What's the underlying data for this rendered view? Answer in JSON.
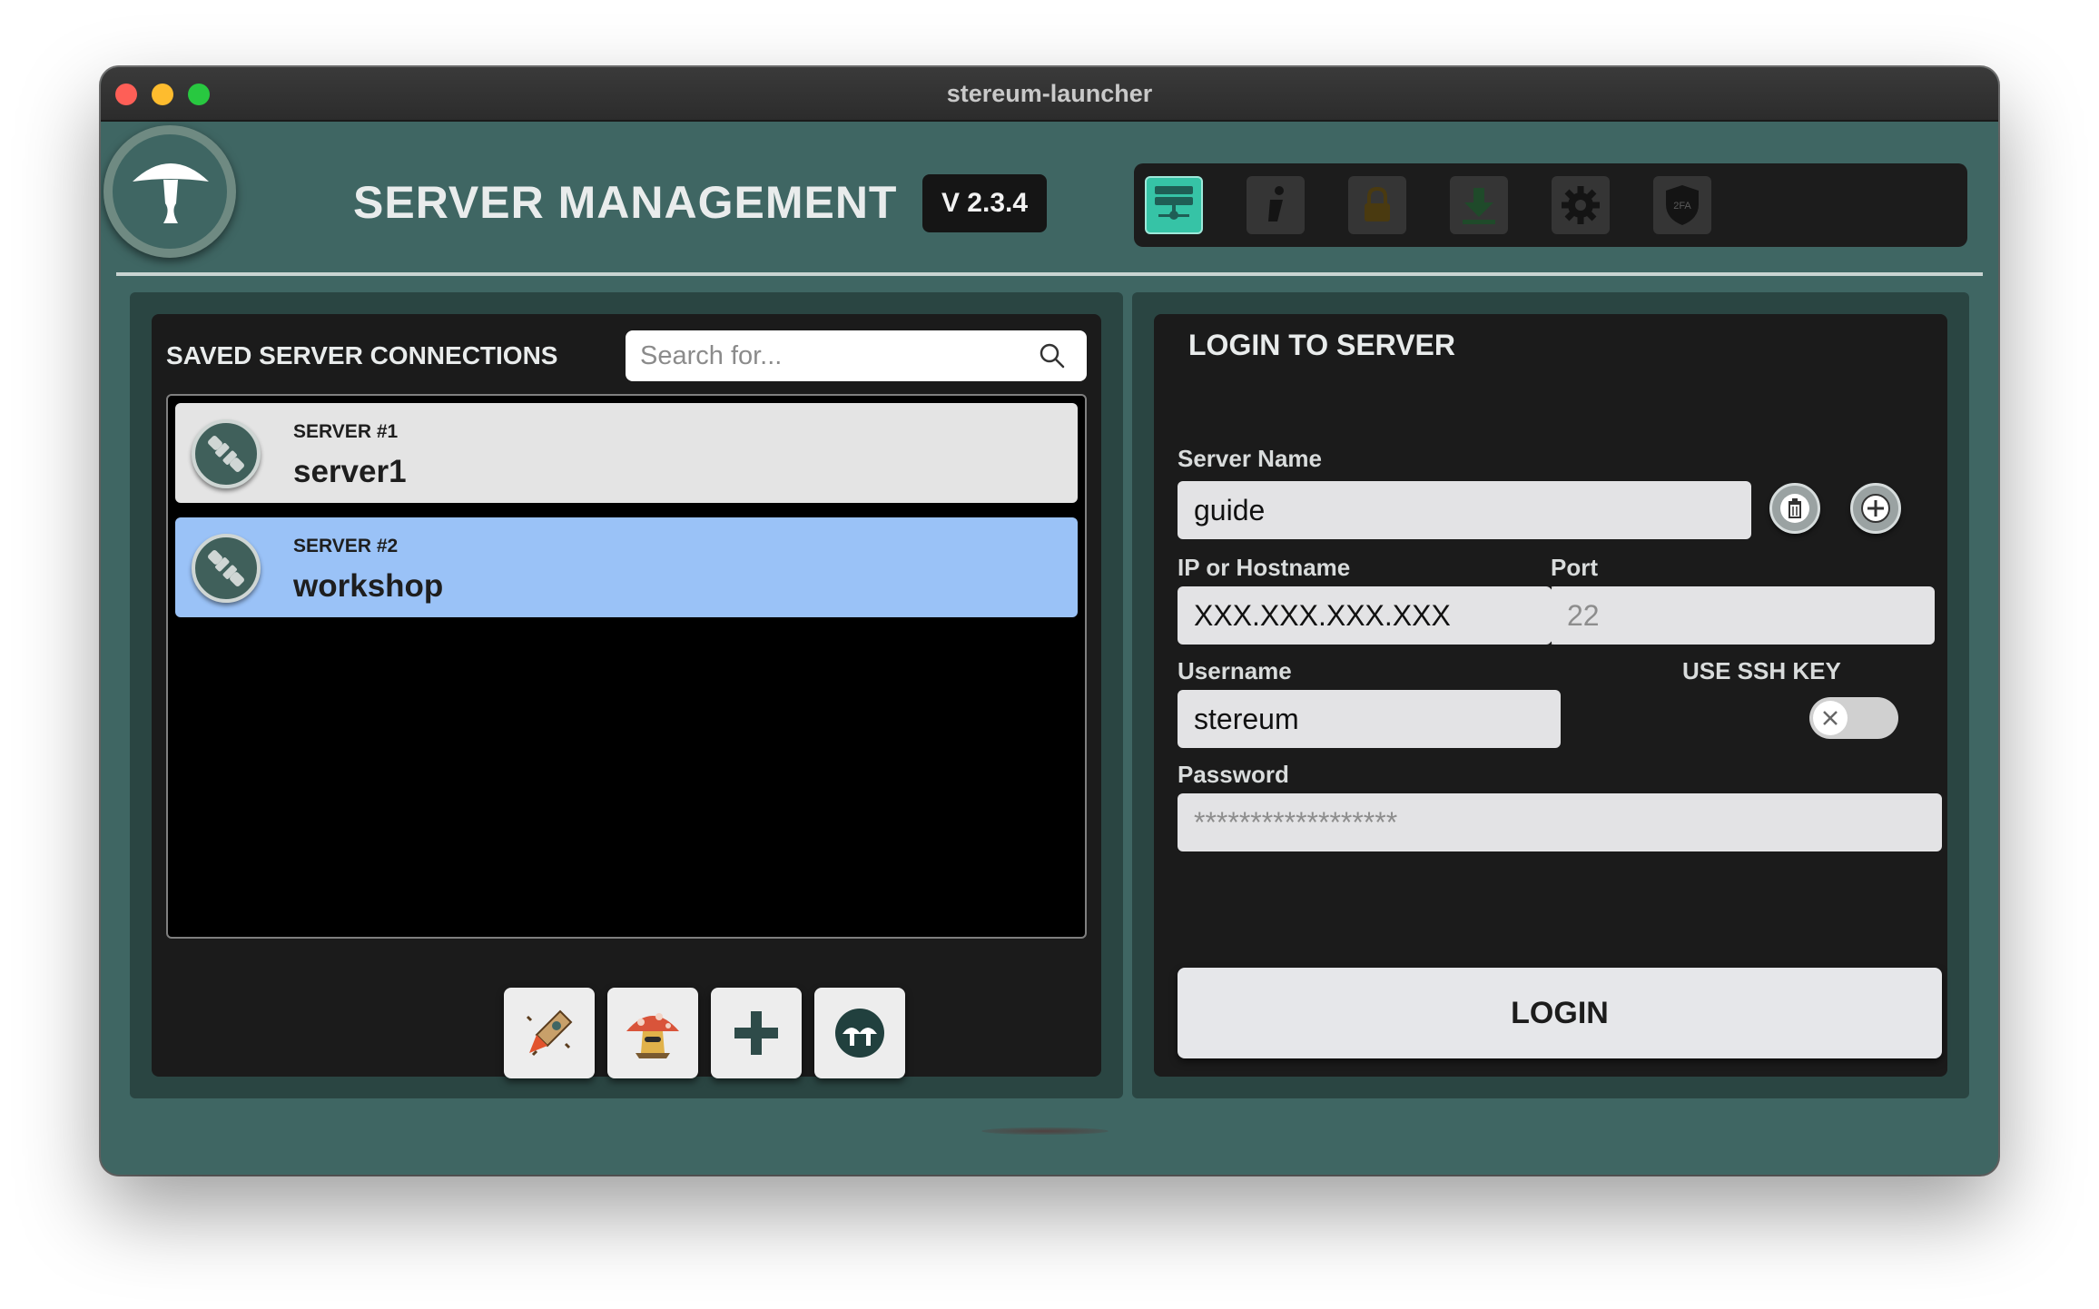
{
  "window": {
    "title": "stereum-launcher"
  },
  "header": {
    "title": "SERVER MANAGEMENT",
    "version": "V 2.3.4"
  },
  "nav": {
    "items": [
      {
        "name": "server-management",
        "icon": "server-icon",
        "active": true
      },
      {
        "name": "info",
        "icon": "info-icon",
        "active": false
      },
      {
        "name": "lock",
        "icon": "lock-icon",
        "active": false
      },
      {
        "name": "download",
        "icon": "download-icon",
        "active": false
      },
      {
        "name": "settings",
        "icon": "gear-icon",
        "active": false
      },
      {
        "name": "2fa",
        "icon": "shield-2fa-icon",
        "label": "2FA",
        "active": false
      }
    ]
  },
  "saved": {
    "title": "SAVED SERVER CONNECTIONS",
    "search_placeholder": "Search for...",
    "servers": [
      {
        "number": "SERVER #1",
        "name": "server1",
        "selected": false
      },
      {
        "number": "SERVER #2",
        "name": "workshop",
        "selected": true
      }
    ],
    "actions": [
      {
        "name": "import-backup",
        "icon": "rocket-icon"
      },
      {
        "name": "mushroom-character",
        "icon": "mushroom-character-icon"
      },
      {
        "name": "add-server",
        "icon": "plus-icon"
      },
      {
        "name": "stereum",
        "icon": "stereum-logo-icon"
      }
    ]
  },
  "login": {
    "title": "LOGIN TO SERVER",
    "server_name_label": "Server Name",
    "server_name_value": "guide",
    "ip_label": "IP or Hostname",
    "ip_value": "XXX.XXX.XXX.XXX",
    "port_label": "Port",
    "port_placeholder": "22",
    "username_label": "Username",
    "username_value": "stereum",
    "ssh_label": "USE SSH KEY",
    "ssh_enabled": false,
    "password_label": "Password",
    "password_placeholder": "******************",
    "login_button": "LOGIN"
  },
  "colors": {
    "background": "#3f6663",
    "panel": "#2a4542",
    "accent": "#36c3a6",
    "selected_row": "#9ac2f7"
  }
}
